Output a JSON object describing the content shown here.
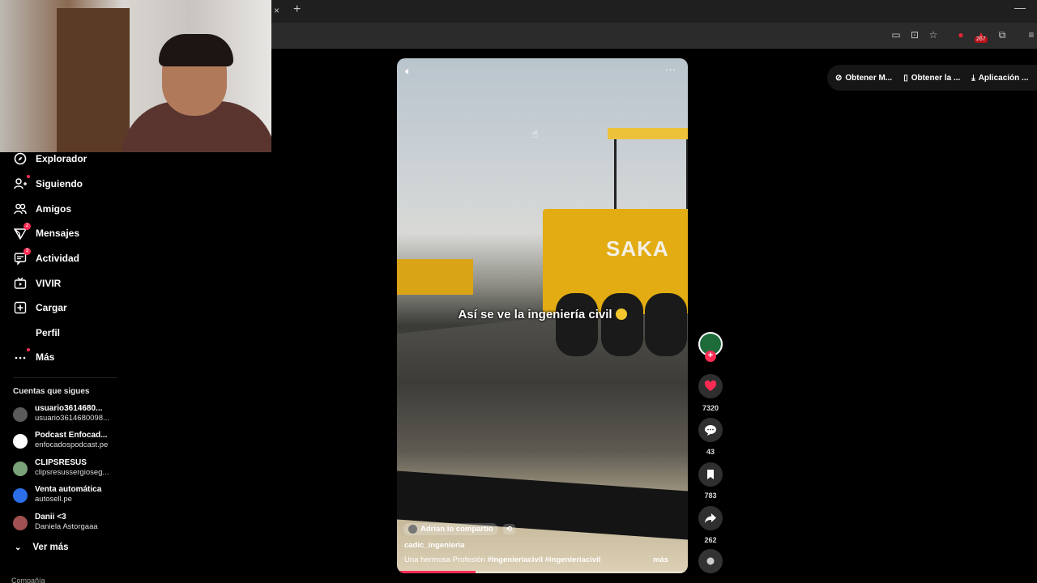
{
  "browser": {
    "tab_close": "×",
    "tab_new": "+",
    "minimize": "—",
    "extension_badge": "267"
  },
  "sidebar": {
    "items": [
      {
        "label": "Explorador",
        "icon": "compass-icon"
      },
      {
        "label": "Siguiendo",
        "icon": "person-plus-icon"
      },
      {
        "label": "Amigos",
        "icon": "friends-icon"
      },
      {
        "label": "Mensajes",
        "icon": "inbox-icon",
        "badge": "2"
      },
      {
        "label": "Actividad",
        "icon": "activity-icon",
        "badge": "3"
      },
      {
        "label": "VIVIR",
        "icon": "live-tv-icon"
      },
      {
        "label": "Cargar",
        "icon": "plus-square-icon"
      },
      {
        "label": "Perfil",
        "icon": "profile-icon"
      },
      {
        "label": "Más",
        "icon": "more-icon"
      }
    ],
    "following_header": "Cuentas que sigues",
    "accounts": [
      {
        "name": "usuario3614680...",
        "handle": "usuario3614680098...",
        "color": "#5a5a5a"
      },
      {
        "name": "Podcast Enfocad...",
        "handle": "enfocadospodcast.pe",
        "color": "#ffffff"
      },
      {
        "name": "CLIPSRESUS",
        "handle": "clipsresussergioseg...",
        "color": "#7aa37a"
      },
      {
        "name": "Venta automática",
        "handle": "autosell.pe",
        "color": "#2b6ee8"
      },
      {
        "name": "Danii <3",
        "handle": "Daniela Astorgaaa",
        "color": "#a05050"
      }
    ],
    "see_more": "Ver más",
    "company": "Compañía"
  },
  "video": {
    "caption": "Así se ve la ingeniería civil",
    "machine_text": "SAKA",
    "shared_by": "Adrian lo compartió",
    "author": "cadic_ingenieria",
    "description": "Una hermosa Profesión",
    "tags": "#ingenieriacivil  #ingenieriacivil",
    "more": "más",
    "progress": 0.27
  },
  "actions": {
    "likes": "7320",
    "comments": "43",
    "saves": "783",
    "shares": "262"
  },
  "top_menu": [
    {
      "label": "Obtener M...",
      "icon": "coin-icon"
    },
    {
      "label": "Obtener la ...",
      "icon": "phone-icon"
    },
    {
      "label": "Aplicación ...",
      "icon": "download-icon"
    }
  ],
  "colors": {
    "accent": "#fe2c55",
    "background": "#000000"
  }
}
